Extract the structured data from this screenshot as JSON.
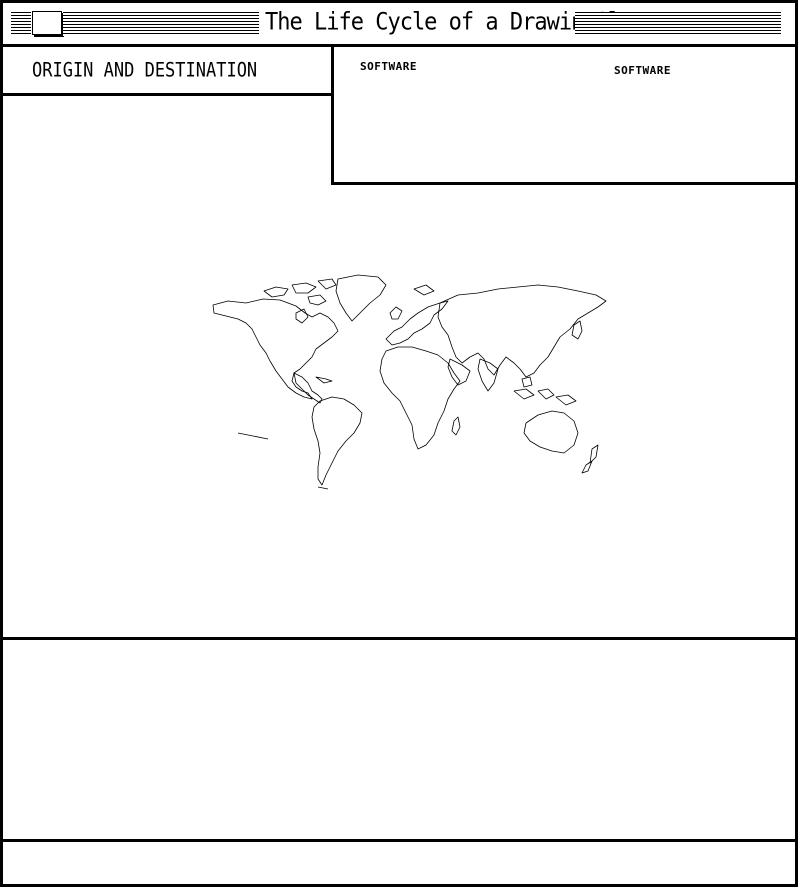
{
  "window": {
    "title": "The Life Cycle of a DrawingSlate II"
  },
  "origin_panel": {
    "label": "ORIGIN AND DESTINATION"
  },
  "software_panel": {
    "label_left": "SOFTWARE",
    "label_right": "SOFTWARE"
  },
  "map": {
    "icon": "world-map-outline"
  },
  "colors": {
    "foreground": "#000000",
    "background": "#ffffff"
  }
}
